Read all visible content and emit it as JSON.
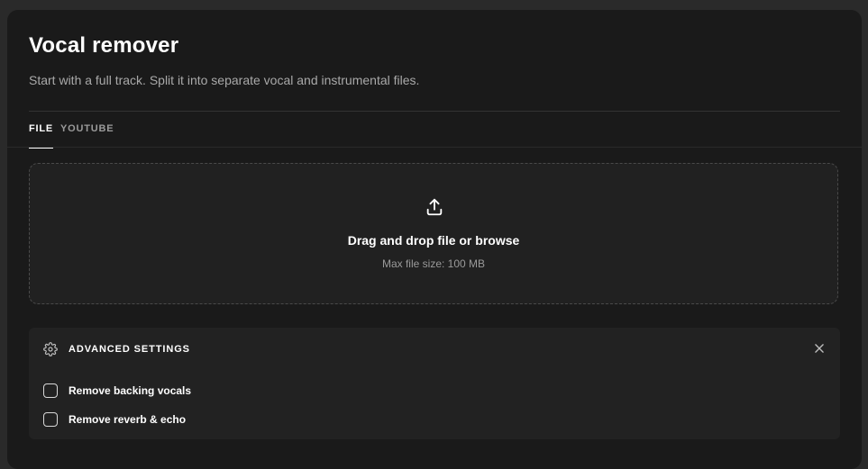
{
  "header": {
    "title": "Vocal remover",
    "subtitle": "Start with a full track. Split it into separate vocal and instrumental files."
  },
  "tabs": [
    {
      "label": "FILE",
      "active": true
    },
    {
      "label": "YOUTUBE",
      "active": false
    }
  ],
  "dropzone": {
    "icon": "upload-icon",
    "text": "Drag and drop file or browse",
    "hint": "Max file size: 100 MB"
  },
  "advanced": {
    "icon": "gear-icon",
    "title": "ADVANCED SETTINGS",
    "close_icon": "close-icon",
    "options": [
      {
        "label": "Remove backing vocals",
        "checked": false
      },
      {
        "label": "Remove reverb & echo",
        "checked": false
      }
    ]
  },
  "colors": {
    "background": "#2a2a2a",
    "card": "#1a1a1a",
    "dropzone": "#212121",
    "panel": "#222222",
    "text_primary": "#ffffff",
    "text_secondary": "#a9a9a9"
  }
}
